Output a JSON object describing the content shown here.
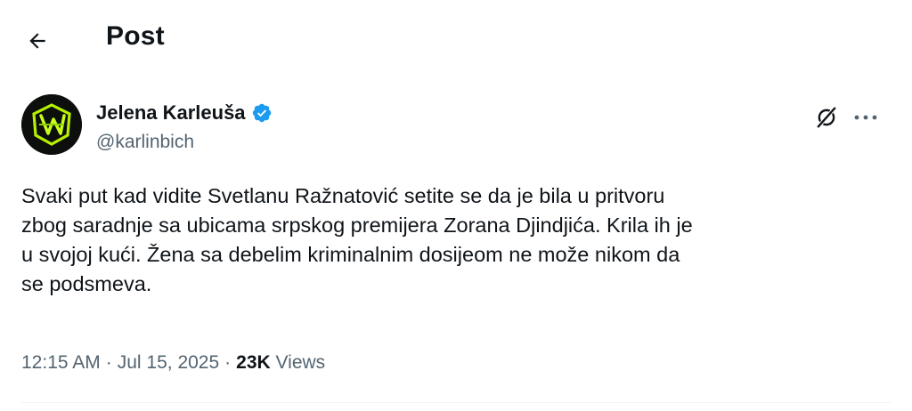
{
  "header": {
    "title": "Post",
    "back_icon": "arrow-left-icon"
  },
  "tweet": {
    "author": {
      "name": "Jelena Karleuša",
      "handle": "@karlinbich",
      "verified": true,
      "verified_color": "#1d9bf0"
    },
    "text": "Svaki put kad vidite Svetlanu Ražnatović setite se da je bila u pritvoru\nzbog saradnje sa ubicama srpskog premijera Zorana Djindjića. Krila ih je\nu svojoj kući. Žena sa debelim kriminalnim dosijeom ne može nikom da\nse podsmeva.",
    "time": "12:15 AM",
    "date": "Jul 15, 2025",
    "separator": "·",
    "views_count": "23K",
    "views_label": "Views"
  },
  "icons": {
    "grok": "grok-icon",
    "more": "more-options-icon"
  },
  "colors": {
    "text": "#0f1419",
    "secondary": "#536471",
    "accent": "#1d9bf0",
    "avatar_glow": "#b7f000"
  }
}
